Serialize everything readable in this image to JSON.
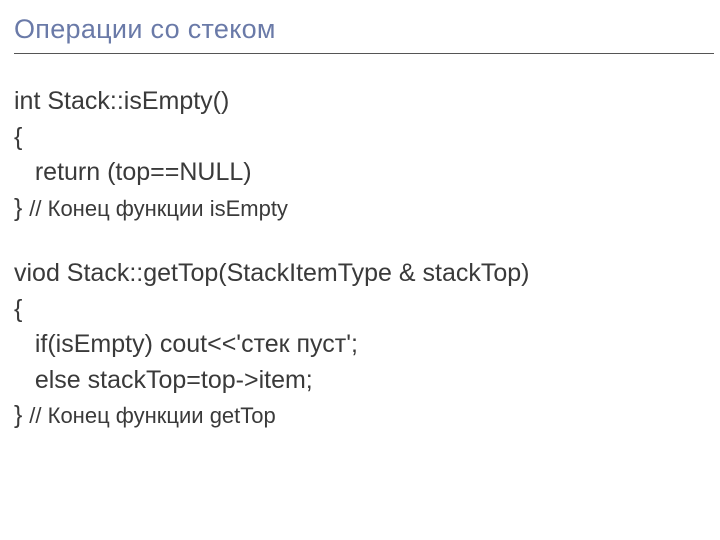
{
  "title": "Операции со стеком",
  "code": {
    "fn1": {
      "sig": "int Stack::isEmpty()",
      "open": "{",
      "l1": "   return (top==NULL)",
      "close": "} ",
      "close_comment": "// Конец функции isEmpty"
    },
    "fn2": {
      "sig": "viod Stack::getTop(StackItemTypе & stackTop)",
      "open": "{",
      "l1": "   if(isEmpty) cout<<'стек пуст';",
      "l2": "   else stackTop=top->item;",
      "close": "} ",
      "close_comment": "// Конец функции getTop"
    }
  }
}
